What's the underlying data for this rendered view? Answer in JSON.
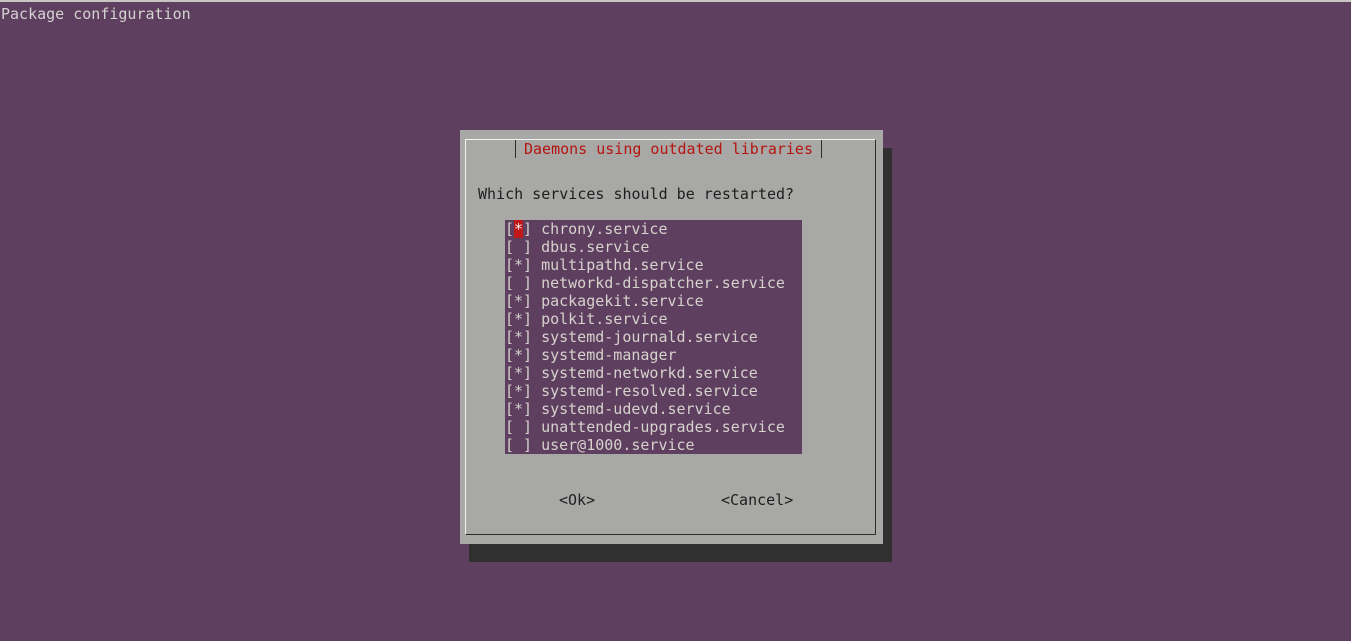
{
  "window": {
    "title": "Package configuration"
  },
  "dialog": {
    "title": "Daemons using outdated libraries",
    "question": "Which services should be restarted?",
    "services": [
      {
        "checked": true,
        "mark": "*",
        "name": "chrony.service",
        "focused": true
      },
      {
        "checked": false,
        "mark": " ",
        "name": "dbus.service"
      },
      {
        "checked": true,
        "mark": "*",
        "name": "multipathd.service"
      },
      {
        "checked": false,
        "mark": " ",
        "name": "networkd-dispatcher.service"
      },
      {
        "checked": true,
        "mark": "*",
        "name": "packagekit.service"
      },
      {
        "checked": true,
        "mark": "*",
        "name": "polkit.service"
      },
      {
        "checked": true,
        "mark": "*",
        "name": "systemd-journald.service"
      },
      {
        "checked": true,
        "mark": "*",
        "name": "systemd-manager"
      },
      {
        "checked": true,
        "mark": "*",
        "name": "systemd-networkd.service"
      },
      {
        "checked": true,
        "mark": "*",
        "name": "systemd-resolved.service"
      },
      {
        "checked": true,
        "mark": "*",
        "name": "systemd-udevd.service"
      },
      {
        "checked": false,
        "mark": " ",
        "name": "unattended-upgrades.service"
      },
      {
        "checked": false,
        "mark": " ",
        "name": "user@1000.service"
      }
    ],
    "ok_label": "<Ok>",
    "cancel_label": "<Cancel>"
  },
  "colors": {
    "background": "#5e3f60",
    "dialog": "#a8a8a6",
    "title": "#b5140f",
    "cursor": "#c01818"
  }
}
